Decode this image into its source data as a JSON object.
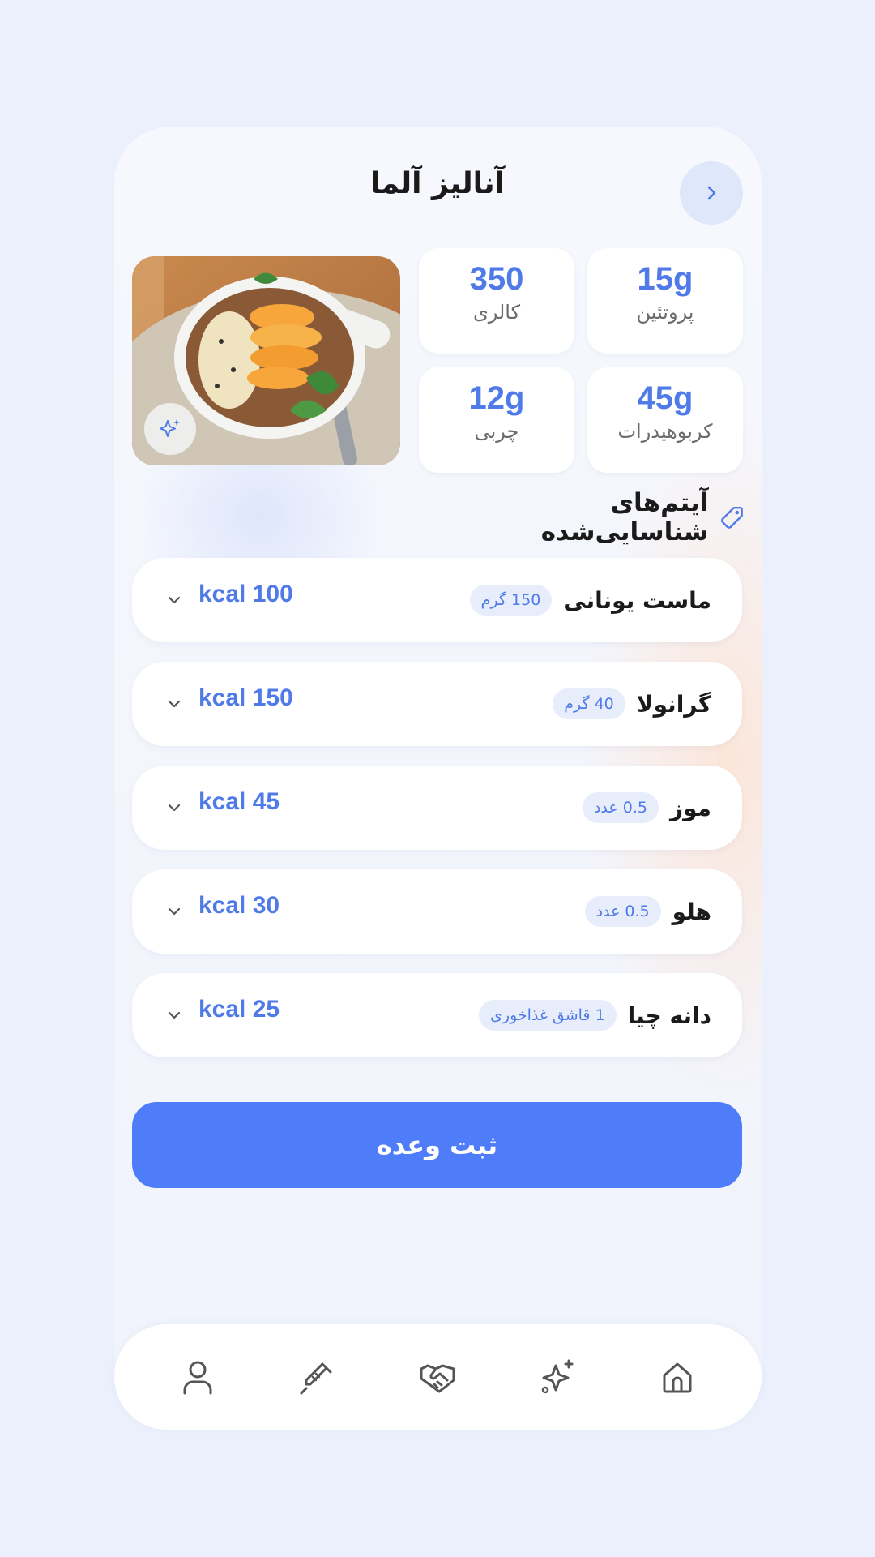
{
  "header": {
    "title": "آنالیز آلما",
    "back_icon": "chevron-right-icon"
  },
  "photo": {
    "alt": "food-photo-bowl",
    "magic_icon": "sparkle-icon"
  },
  "stats": [
    {
      "value": "15g",
      "label": "پروتئین"
    },
    {
      "value": "350",
      "label": "کالری"
    },
    {
      "value": "45g",
      "label": "کربوهیدرات"
    },
    {
      "value": "12g",
      "label": "چربی"
    }
  ],
  "section": {
    "title": "آیتم‌های شناسایی‌شده",
    "icon": "tag-icon"
  },
  "items": [
    {
      "name": "ماست یونانی",
      "qty": "150 گرم",
      "kcal": "kcal 100"
    },
    {
      "name": "گرانولا",
      "qty": "40 گرم",
      "kcal": "kcal 150"
    },
    {
      "name": "موز",
      "qty": "0.5 عدد",
      "kcal": "kcal 45"
    },
    {
      "name": "هلو",
      "qty": "0.5 عدد",
      "kcal": "kcal 30"
    },
    {
      "name": "دانه چیا",
      "qty": "1 قاشق غذاخوری",
      "kcal": "kcal 25"
    }
  ],
  "submit": {
    "label": "ثبت وعده"
  },
  "nav": [
    {
      "name": "home",
      "icon": "home-icon"
    },
    {
      "name": "ai",
      "icon": "sparkles-icon"
    },
    {
      "name": "handshake",
      "icon": "handshake-icon"
    },
    {
      "name": "syringe",
      "icon": "syringe-icon"
    },
    {
      "name": "profile",
      "icon": "user-icon"
    }
  ],
  "colors": {
    "accent": "#4f7dfa",
    "accent_text": "#4f7ae8",
    "background": "#ebf0fc"
  }
}
